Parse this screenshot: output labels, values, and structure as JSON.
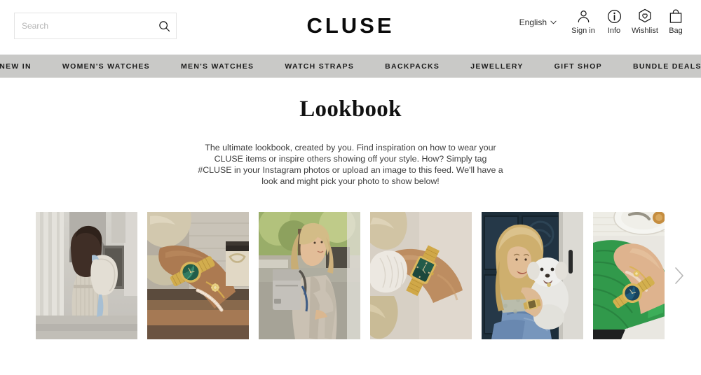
{
  "header": {
    "search": {
      "placeholder": "Search",
      "value": "",
      "icon": "search-icon"
    },
    "logo": "CLUSE",
    "language": {
      "label": "English",
      "icon": "chevron-down-icon"
    },
    "utilities": [
      {
        "label": "Sign in",
        "icon": "user-icon"
      },
      {
        "label": "Info",
        "icon": "info-circle-icon"
      },
      {
        "label": "Wishlist",
        "icon": "hexagon-heart-icon"
      },
      {
        "label": "Bag",
        "icon": "shopping-bag-icon"
      }
    ]
  },
  "nav": {
    "background_color": "#c9c9c7",
    "items": [
      {
        "label": "NEW IN"
      },
      {
        "label": "WOMEN'S WATCHES"
      },
      {
        "label": "MEN'S WATCHES"
      },
      {
        "label": "WATCH STRAPS"
      },
      {
        "label": "BACKPACKS"
      },
      {
        "label": "JEWELLERY"
      },
      {
        "label": "GIFT SHOP"
      },
      {
        "label": "BUNDLE DEALS"
      }
    ]
  },
  "main": {
    "title": "Lookbook",
    "intro": "The ultimate lookbook, created by you. Find inspiration on how to wear your CLUSE items or inspire others showing off your style. How? Simply tag #CLUSE in your Instagram photos or upload an image to this feed. We'll have a look and might pick your photo to show below!"
  },
  "gallery": {
    "next_icon": "chevron-right-icon",
    "items": [
      {
        "alt": "Woman from behind with cream backpack among classical stone columns"
      },
      {
        "alt": "Wrist with gold watch with green malachite dial, pearl bracelets and coffee cup"
      },
      {
        "alt": "Blonde woman outdoors wearing beige coat with grey backpack"
      },
      {
        "alt": "Arm with gold rectangular watch with dark green dial and white ruffled sleeve"
      },
      {
        "alt": "Blonde woman sitting on doorstep holding a white fluffy dog"
      },
      {
        "alt": "Arm with gold watch resting on green knit jumper beside a white plate"
      }
    ]
  }
}
